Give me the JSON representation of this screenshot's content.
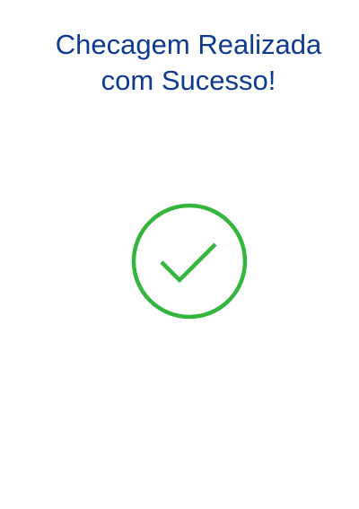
{
  "screen": {
    "title_line1": "Checagem Realizada",
    "title_line2": "com Sucesso!",
    "icon": "check-circle-icon",
    "title_color": "#0d3b91",
    "icon_color": "#34b63e"
  }
}
